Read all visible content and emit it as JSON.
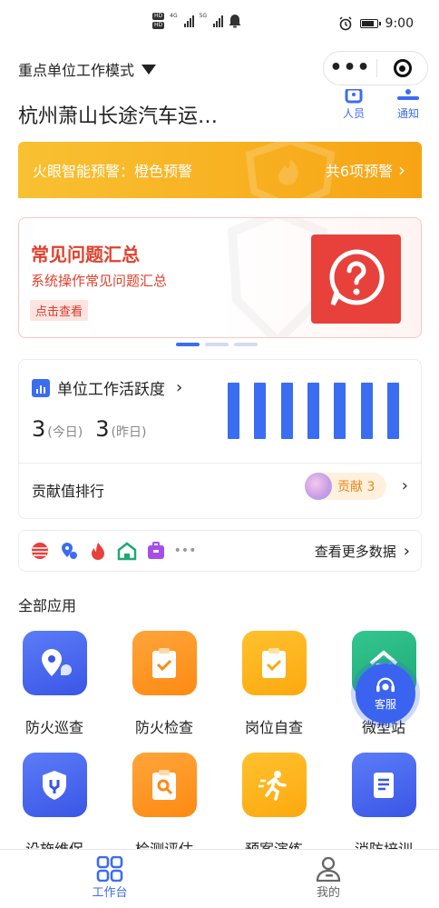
{
  "status_bar": {
    "time": "9:00",
    "hd1": "HD",
    "hd2": "HD",
    "net1": "4G",
    "net2": "5G"
  },
  "header": {
    "mode_label": "重点单位工作模式",
    "company_name": "杭州萧山长途汽车运…",
    "personnel_label": "人员",
    "notice_label": "通知"
  },
  "alert": {
    "text": "火眼智能预警：橙色预警",
    "count_text": "共6项预警"
  },
  "banner": {
    "title": "常见问题汇总",
    "subtitle": "系统操作常见问题汇总",
    "cta": "点击查看"
  },
  "activity": {
    "title": "单位工作活跃度",
    "today_value": "3",
    "today_label": "(今日)",
    "yesterday_value": "3",
    "yesterday_label": "(昨日)",
    "bars": [
      1,
      1,
      1,
      1,
      1,
      1,
      1
    ],
    "rank_label": "贡献值排行",
    "contrib_label": "贡献 3"
  },
  "data_row": {
    "more_label": "查看更多数据",
    "ellipsis": "•••"
  },
  "apps": {
    "section_title": "全部应用",
    "items": [
      {
        "label": "防火巡查",
        "icon": "location-chat-icon"
      },
      {
        "label": "防火检查",
        "icon": "clipboard-check-icon"
      },
      {
        "label": "岗位自查",
        "icon": "clipboard-check-icon"
      },
      {
        "label": "微型站",
        "icon": "station-icon"
      },
      {
        "label": "设施维保",
        "icon": "shield-wrench-icon"
      },
      {
        "label": "检测评估",
        "icon": "clipboard-search-icon"
      },
      {
        "label": "预案演练",
        "icon": "running-man-icon"
      },
      {
        "label": "消防培训",
        "icon": "book-icon"
      }
    ]
  },
  "support": {
    "label": "客服"
  },
  "tabbar": {
    "workbench": "工作台",
    "mine": "我的"
  },
  "colors": {
    "primary": "#3b6df2",
    "alert_orange": "#f7a413",
    "banner_red": "#e0412d"
  }
}
